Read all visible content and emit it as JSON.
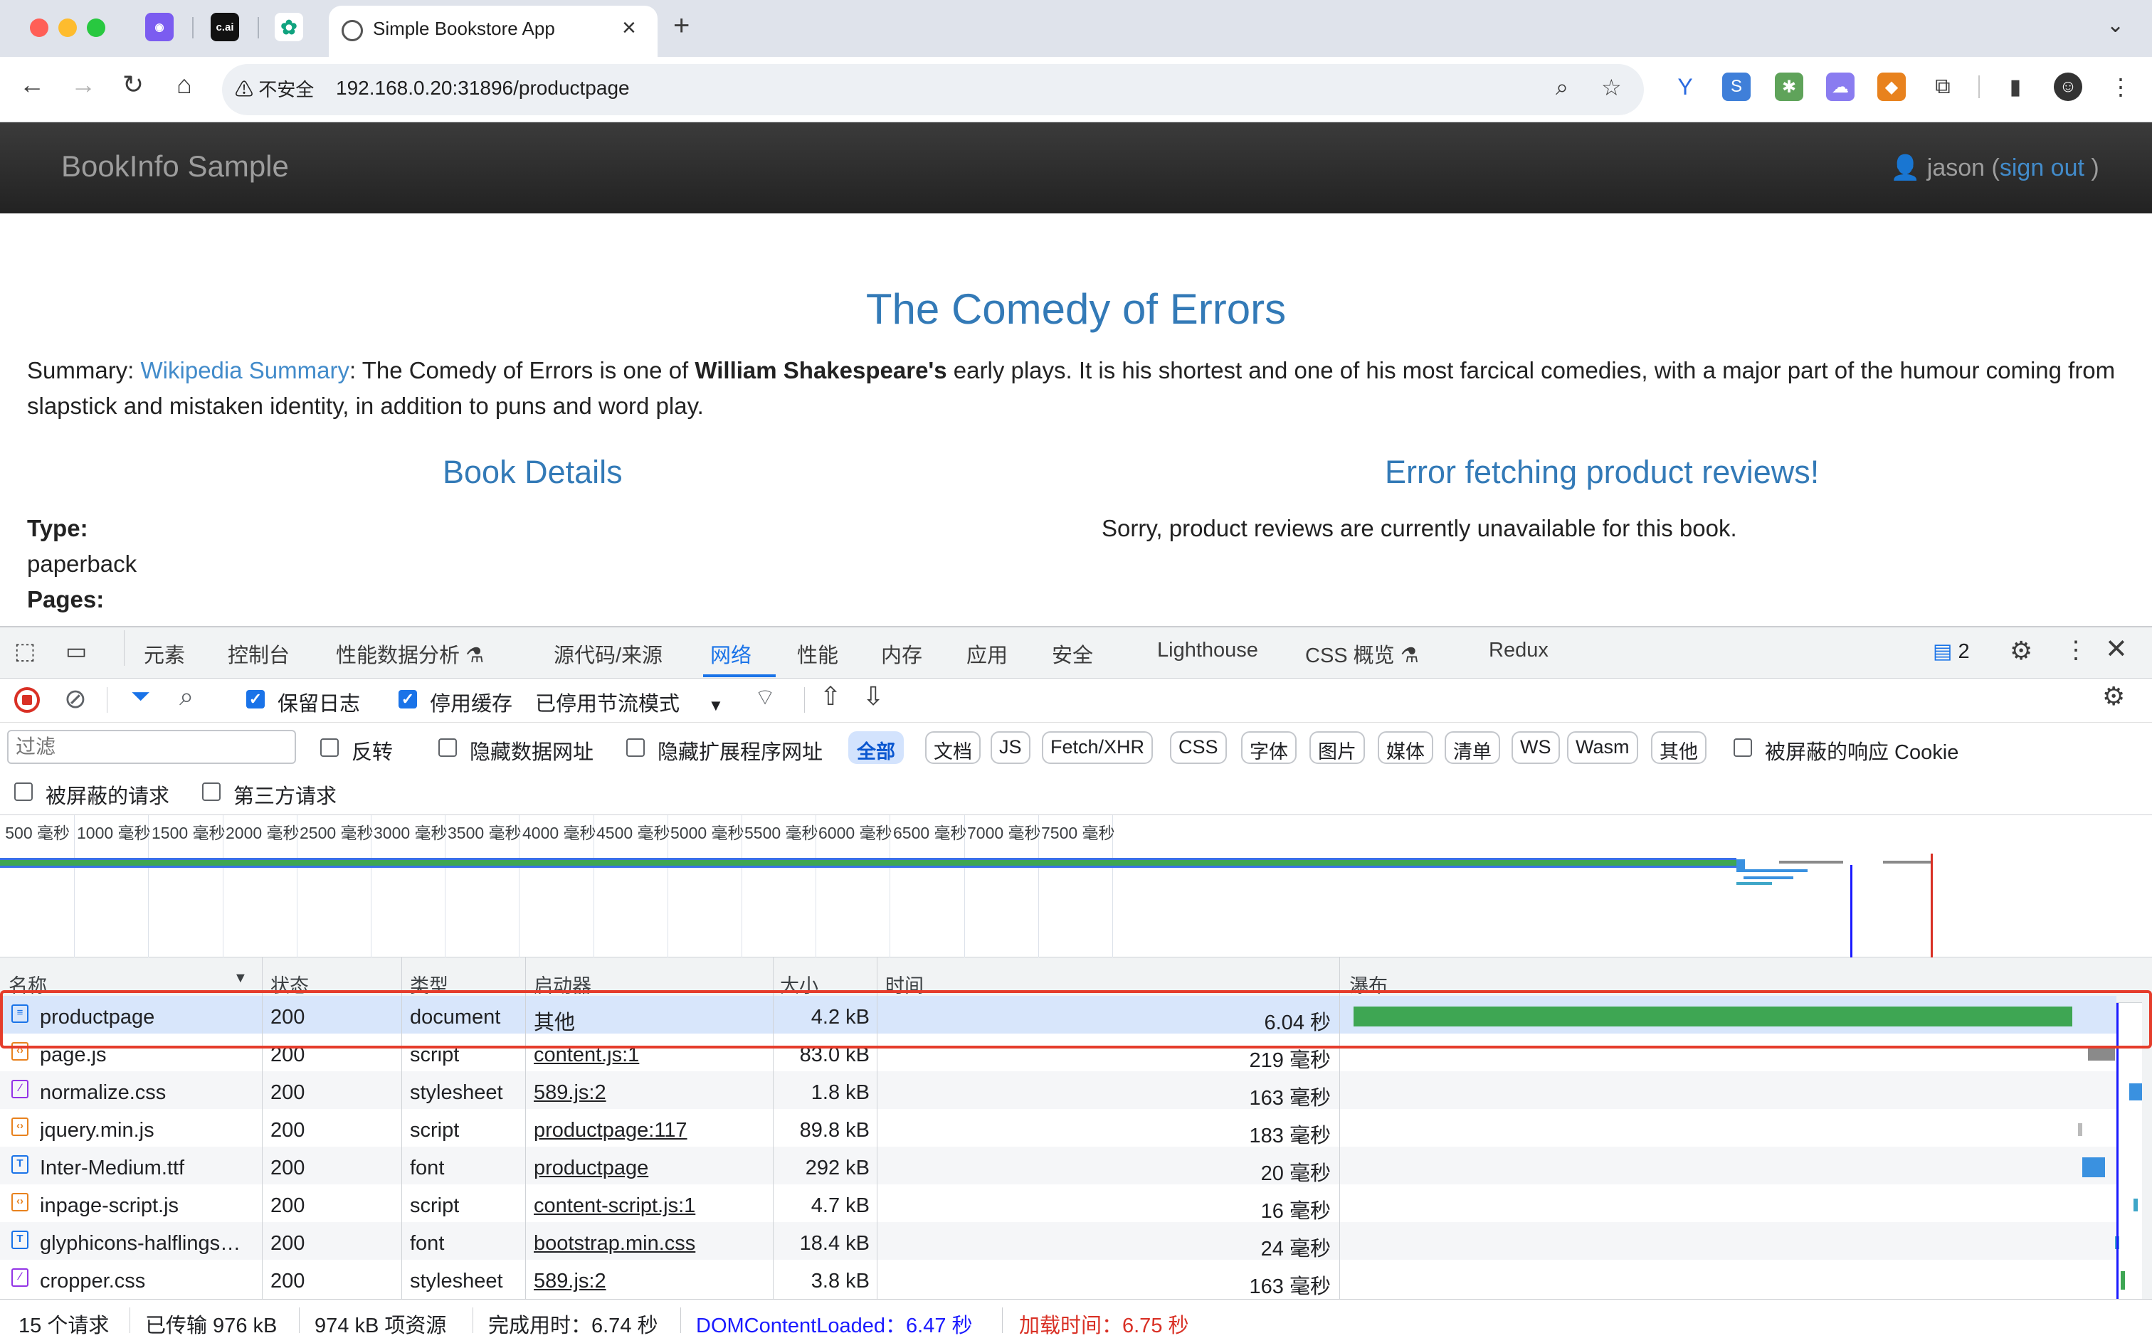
{
  "browser": {
    "pinned_tabs": [
      "c.ai"
    ],
    "active_tab_title": "Simple Bookstore App",
    "insecure_label": "不安全",
    "url": "192.168.0.20:31896/productpage"
  },
  "page": {
    "brand": "BookInfo Sample",
    "user": "jason",
    "user_open": "(",
    "sign_out": "sign out",
    "user_close": ")",
    "title": "The Comedy of Errors",
    "summary_label": "Summary: ",
    "summary_link": "Wikipedia Summary",
    "summary_pre": ": The Comedy of Errors is one of ",
    "summary_bold": "William Shakespeare's",
    "summary_post": " early plays. It is his shortest and one of his most farcical comedies, with a major part of the humour coming from slapstick and mistaken identity, in addition to puns and word play.",
    "details_heading": "Book Details",
    "reviews_heading": "Error fetching product reviews!",
    "reviews_text": "Sorry, product reviews are currently unavailable for this book.",
    "type_label": "Type:",
    "type_value": "paperback",
    "pages_label": "Pages:"
  },
  "devtools": {
    "tabs": [
      "元素",
      "控制台",
      "性能数据分析",
      "源代码/来源",
      "网络",
      "性能",
      "内存",
      "应用",
      "安全",
      "Lighthouse",
      "CSS 概览",
      "Redux"
    ],
    "active_tab": "网络",
    "issues_count": "2",
    "toolbar": {
      "preserve_log": "保留日志",
      "disable_cache": "停用缓存",
      "throttling": "已停用节流模式"
    },
    "filter": {
      "placeholder": "过滤",
      "invert": "反转",
      "hide_data_urls": "隐藏数据网址",
      "hide_ext_urls": "隐藏扩展程序网址",
      "types": [
        "全部",
        "文档",
        "JS",
        "Fetch/XHR",
        "CSS",
        "字体",
        "图片",
        "媒体",
        "清单",
        "WS",
        "Wasm",
        "其他"
      ],
      "blocked_cookies": "被屏蔽的响应 Cookie",
      "blocked_requests": "被屏蔽的请求",
      "third_party": "第三方请求"
    },
    "timeline_ticks": [
      "500 毫秒",
      "1000 毫秒",
      "1500 毫秒",
      "2000 毫秒",
      "2500 毫秒",
      "3000 毫秒",
      "3500 毫秒",
      "4000 毫秒",
      "4500 毫秒",
      "5000 毫秒",
      "5500 毫秒",
      "6000 毫秒",
      "6500 毫秒",
      "7000 毫秒",
      "7500 毫秒"
    ],
    "columns": {
      "name": "名称",
      "status": "状态",
      "type": "类型",
      "initiator": "启动器",
      "size": "大小",
      "time": "时间",
      "waterfall": "瀑布"
    },
    "requests": [
      {
        "name": "productpage",
        "status": "200",
        "type": "document",
        "initiator": "其他",
        "size": "4.2 kB",
        "time": "6.04 秒",
        "icon": "document-icon"
      },
      {
        "name": "page.js",
        "status": "200",
        "type": "script",
        "initiator": "content.js:1",
        "size": "83.0 kB",
        "time": "219 毫秒",
        "icon": "script-icon"
      },
      {
        "name": "normalize.css",
        "status": "200",
        "type": "stylesheet",
        "initiator": "589.js:2",
        "size": "1.8 kB",
        "time": "163 毫秒",
        "icon": "stylesheet-icon"
      },
      {
        "name": "jquery.min.js",
        "status": "200",
        "type": "script",
        "initiator": "productpage:117",
        "size": "89.8 kB",
        "time": "183 毫秒",
        "icon": "script-icon"
      },
      {
        "name": "Inter-Medium.ttf",
        "status": "200",
        "type": "font",
        "initiator": "productpage",
        "size": "292 kB",
        "time": "20 毫秒",
        "icon": "font-icon"
      },
      {
        "name": "inpage-script.js",
        "status": "200",
        "type": "script",
        "initiator": "content-script.js:1",
        "size": "4.7 kB",
        "time": "16 毫秒",
        "icon": "script-icon"
      },
      {
        "name": "glyphicons-halflings…",
        "status": "200",
        "type": "font",
        "initiator": "bootstrap.min.css",
        "size": "18.4 kB",
        "time": "24 毫秒",
        "icon": "font-icon"
      },
      {
        "name": "cropper.css",
        "status": "200",
        "type": "stylesheet",
        "initiator": "589.js:2",
        "size": "3.8 kB",
        "time": "163 毫秒",
        "icon": "stylesheet-icon"
      }
    ],
    "status": {
      "requests": "15 个请求",
      "transferred": "已传输 976 kB",
      "resources": "974 kB 项资源",
      "finish": "完成用时：6.74 秒",
      "dom_content_loaded": "DOMContentLoaded：6.47 秒",
      "load": "加载时间：6.75 秒"
    },
    "colors": {
      "accent": "#1a73e8",
      "dcl_line": "#1a1aff",
      "load_line": "#d93025",
      "waiting_bar": "#3ea653",
      "download_bar": "#3a91e0"
    }
  }
}
